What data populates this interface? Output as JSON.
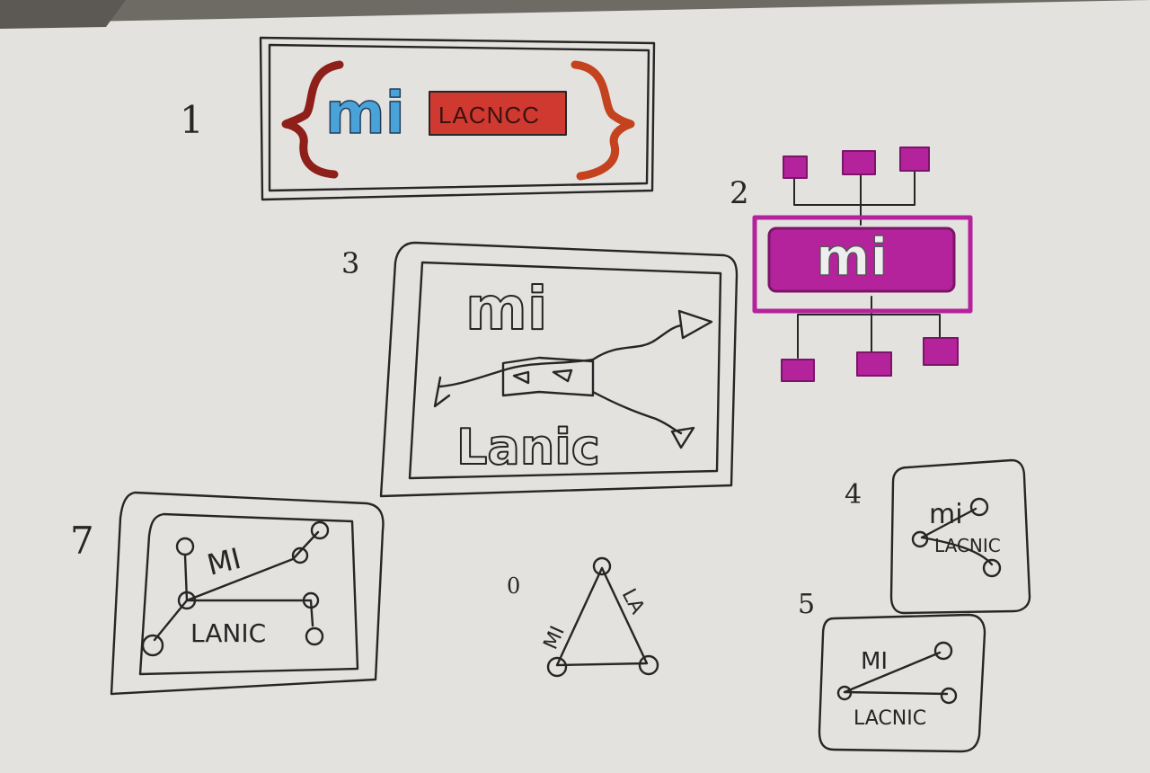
{
  "colors": {
    "paper": "#e4e2df",
    "paper_shadow": "#cfccc8",
    "ink": "#262626",
    "blue_ink": "#4aa3d8",
    "red_ink": "#d0392f",
    "orange_ink": "#c4431e",
    "magenta_ink": "#b4239c"
  },
  "sketches": [
    {
      "number": "1",
      "wordmark_mi": "mi",
      "wordmark_lacnic": "LACNCC"
    },
    {
      "number": "2",
      "wordmark_mi": "mi"
    },
    {
      "number": "3",
      "wordmark_mi": "mi",
      "wordmark_lacnic": "Lanic"
    },
    {
      "number": "4",
      "wordmark_mi": "mi",
      "wordmark_lacnic": "LACNIC"
    },
    {
      "number": "5",
      "wordmark_mi": "MI",
      "wordmark_lacnic": "LACNIC"
    },
    {
      "number": "0",
      "wordmark_mi": "MI",
      "wordmark_lacnic": "LA"
    },
    {
      "number": "7",
      "wordmark_mi": "MI",
      "wordmark_lacnic": "LANIC"
    }
  ]
}
